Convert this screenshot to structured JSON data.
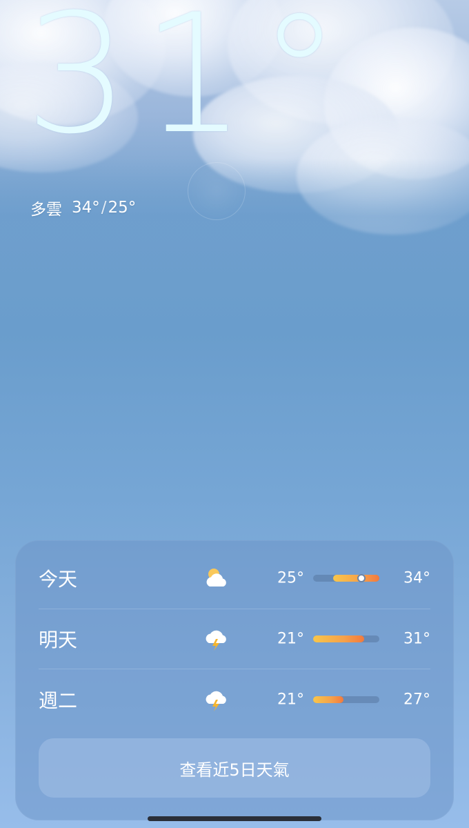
{
  "current": {
    "temperature": "31",
    "degree_symbol": "°",
    "condition": "多雲",
    "high": "34°",
    "range_separator": "/",
    "low": "25°"
  },
  "forecast": {
    "days": [
      {
        "label": "今天",
        "icon": "partly-cloudy-icon",
        "low": "25°",
        "high": "34°",
        "bar_start_fraction": 0.3,
        "bar_end_fraction": 1.0,
        "current_marker_fraction": 0.73
      },
      {
        "label": "明天",
        "icon": "thunderstorm-icon",
        "low": "21°",
        "high": "31°",
        "bar_start_fraction": 0.0,
        "bar_end_fraction": 0.77
      },
      {
        "label": "週二",
        "icon": "thunderstorm-icon",
        "low": "21°",
        "high": "27°",
        "bar_start_fraction": 0.0,
        "bar_end_fraction": 0.46
      }
    ],
    "more_button_label": "查看近5日天氣"
  },
  "colors": {
    "sky_top": "#b7cbe6",
    "sky_mid": "#6a9dcc",
    "sky_bottom": "#97bdea",
    "bar_warm": "#f6a14a",
    "bar_hot": "#f27a3e",
    "bar_cool": "#f8c64b"
  }
}
